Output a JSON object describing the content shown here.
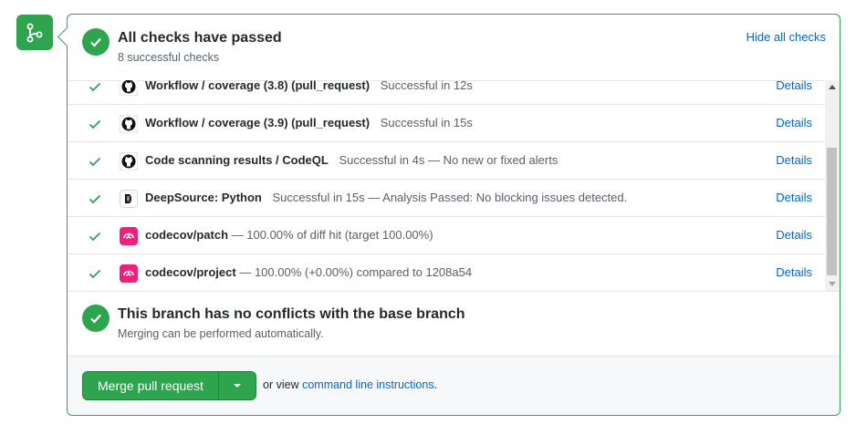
{
  "branch_icon": "git-branch-icon",
  "summary": {
    "title": "All checks have passed",
    "subtitle": "8 successful checks",
    "toggle_link": "Hide all checks"
  },
  "checks": [
    {
      "name": "Workflow / coverage (3.8) (pull_request)",
      "status": "Successful in 12s",
      "icon": "github-icon",
      "details": "Details"
    },
    {
      "name": "Workflow / coverage (3.9) (pull_request)",
      "status": "Successful in 15s",
      "icon": "github-icon",
      "details": "Details"
    },
    {
      "name": "Code scanning results / CodeQL",
      "status": "Successful in 4s — No new or fixed alerts",
      "icon": "github-icon",
      "details": "Details"
    },
    {
      "name": "DeepSource: Python",
      "status": "Successful in 15s — Analysis Passed: No blocking issues detected.",
      "icon": "deepsource-icon",
      "details": "Details"
    },
    {
      "name": "codecov/patch",
      "status": "— 100.00% of diff hit (target 100.00%)",
      "icon": "codecov-icon",
      "details": "Details"
    },
    {
      "name": "codecov/project",
      "status": "— 100.00% (+0.00%) compared to 1208a54",
      "icon": "codecov-icon",
      "details": "Details"
    }
  ],
  "conflict": {
    "title": "This branch has no conflicts with the base branch",
    "subtitle": "Merging can be performed automatically."
  },
  "merge": {
    "button_label": "Merge pull request",
    "note_prefix": "or view",
    "note_link": "command line instructions",
    "note_suffix": "."
  },
  "colors": {
    "success": "#2ea44f",
    "link": "#0366d6",
    "codecov": "#f01f7a"
  }
}
